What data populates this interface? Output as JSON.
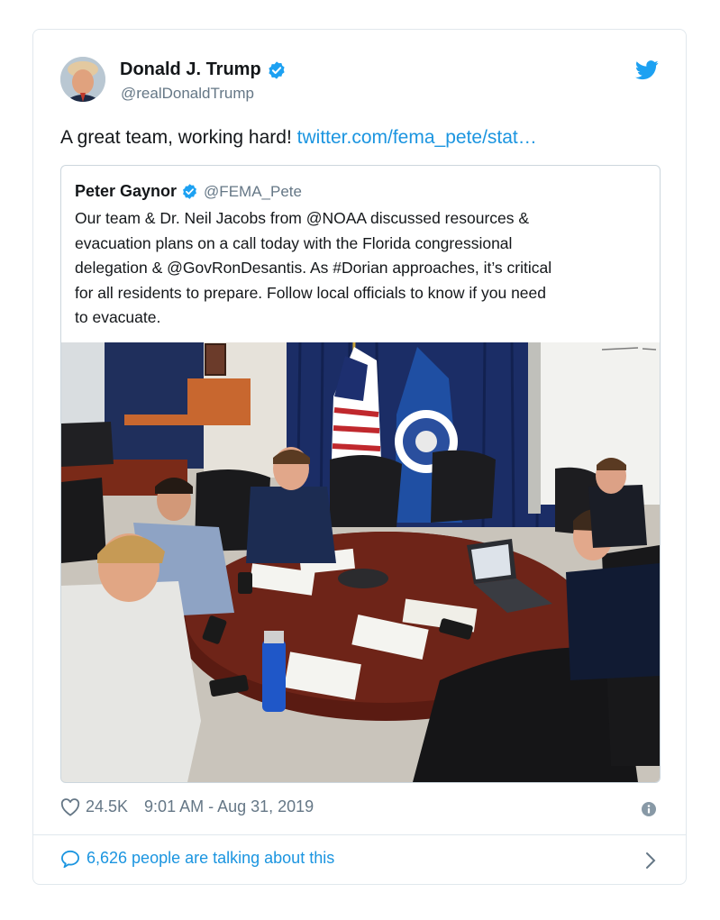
{
  "tweet": {
    "author_name": "Donald J. Trump",
    "author_handle": "@realDonaldTrump",
    "text": "A great team, working hard!",
    "link_text": "twitter.com/fema_pete/stat…",
    "likes": "24.5K",
    "timestamp": "9:01 AM - Aug 31, 2019",
    "talking": "6,626 people are talking about this"
  },
  "quote": {
    "author_name": "Peter Gaynor",
    "author_handle": "@FEMA_Pete",
    "lines": [
      "Our team & Dr. Neil Jacobs from @NOAA discussed resources &",
      "evacuation plans on a call today with the Florida congressional",
      "delegation & @GovRonDesantis. As #Dorian approaches, it’s critical",
      "for all residents to prepare. Follow local officials to know if you need",
      "to evacuate."
    ]
  },
  "colors": {
    "accent": "#1DA1F2",
    "link": "#1B95E0",
    "text": "#14171A",
    "muted": "#657786",
    "border": "#E1E8ED"
  },
  "icons": {
    "verified": "verified-badge-icon",
    "brand": "twitter-bird-icon",
    "like": "heart-icon",
    "info": "info-icon",
    "reply": "speech-bubble-icon",
    "more": "chevron-right-icon"
  }
}
